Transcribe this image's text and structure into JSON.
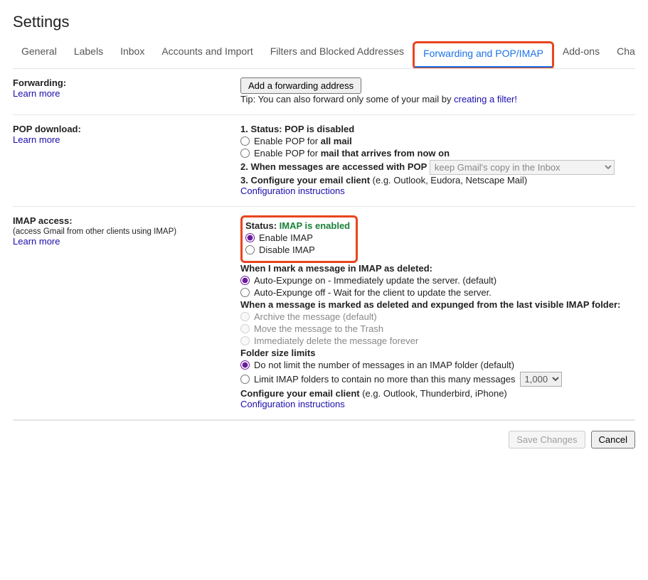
{
  "page_title": "Settings",
  "tabs": {
    "general": "General",
    "labels": "Labels",
    "inbox": "Inbox",
    "accounts": "Accounts and Import",
    "filters": "Filters and Blocked Addresses",
    "forwarding": "Forwarding and POP/IMAP",
    "addons": "Add-ons",
    "chat": "Chat and Meet"
  },
  "forwarding": {
    "title": "Forwarding:",
    "learn_more": "Learn more",
    "add_button": "Add a forwarding address",
    "tip_prefix": "Tip: You can also forward only some of your mail by ",
    "tip_link": "creating a filter!"
  },
  "pop": {
    "title": "POP download:",
    "learn_more": "Learn more",
    "status_line_prefix": "1. Status: ",
    "status_value": "POP is disabled",
    "opt_all_prefix": "Enable POP for ",
    "opt_all_bold": "all mail",
    "opt_now_prefix": "Enable POP for ",
    "opt_now_bold": "mail that arrives from now on",
    "when_accessed": "2. When messages are accessed with POP",
    "keep_copy_option": "keep Gmail's copy in the Inbox",
    "configure_prefix": "3. Configure your email client ",
    "configure_suffix": "(e.g. Outlook, Eudora, Netscape Mail)",
    "config_instructions": "Configuration instructions"
  },
  "imap": {
    "title": "IMAP access:",
    "subtitle": "(access Gmail from other clients using IMAP)",
    "learn_more": "Learn more",
    "status_label": "Status: ",
    "status_value": "IMAP is enabled",
    "enable": "Enable IMAP",
    "disable": "Disable IMAP",
    "deleted_heading": "When I mark a message in IMAP as deleted:",
    "expunge_on": "Auto-Expunge on - Immediately update the server. (default)",
    "expunge_off": "Auto-Expunge off - Wait for the client to update the server.",
    "expunged_heading": "When a message is marked as deleted and expunged from the last visible IMAP folder:",
    "archive": "Archive the message (default)",
    "move_trash": "Move the message to the Trash",
    "delete_forever": "Immediately delete the message forever",
    "folder_limits_heading": "Folder size limits",
    "no_limit": "Do not limit the number of messages in an IMAP folder (default)",
    "limit_prefix": "Limit IMAP folders to contain no more than this many messages",
    "limit_value": "1,000",
    "configure_prefix": "Configure your email client ",
    "configure_suffix": "(e.g. Outlook, Thunderbird, iPhone)",
    "config_instructions": "Configuration instructions"
  },
  "footer": {
    "save": "Save Changes",
    "cancel": "Cancel"
  }
}
